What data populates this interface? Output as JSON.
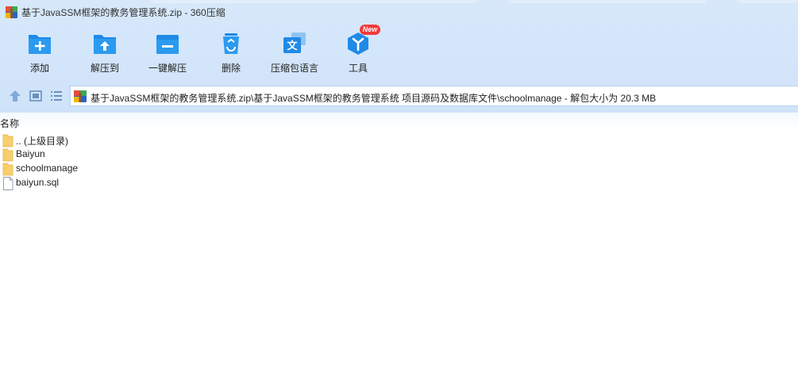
{
  "window": {
    "title": "基于JavaSSM框架的教务管理系统.zip - 360压缩"
  },
  "toolbar": {
    "items": [
      {
        "label": "添加",
        "icon": "add-folder-icon"
      },
      {
        "label": "解压到",
        "icon": "extract-to-icon"
      },
      {
        "label": "一键解压",
        "icon": "one-click-extract-icon"
      },
      {
        "label": "删除",
        "icon": "recycle-bin-icon"
      },
      {
        "label": "压缩包语言",
        "icon": "language-icon"
      },
      {
        "label": "工具",
        "icon": "tools-icon"
      }
    ],
    "badge": "New"
  },
  "address": {
    "path": "基于JavaSSM框架的教务管理系统.zip\\基于JavaSSM框架的教务管理系统 项目源码及数据库文件\\schoolmanage - 解包大小为 20.3 MB"
  },
  "columns": {
    "name": "名称"
  },
  "files": [
    {
      "name": ".. (上级目录)",
      "type": "folder"
    },
    {
      "name": "Baiyun",
      "type": "folder"
    },
    {
      "name": "schoolmanage",
      "type": "folder"
    },
    {
      "name": "baiyun.sql",
      "type": "file"
    }
  ],
  "colors": {
    "accent": "#1e88e5",
    "toolbar_bg": "#d2e5f9",
    "folder": "#f7cf6b"
  }
}
